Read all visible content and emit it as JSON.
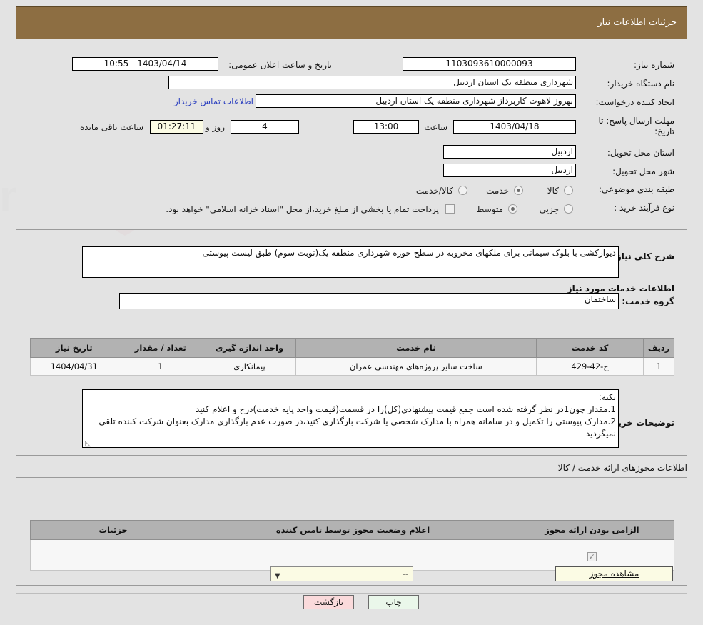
{
  "header": {
    "title": "جزئیات اطلاعات نیاز"
  },
  "summary": {
    "need_number_label": "شماره نیاز:",
    "need_number_value": "1103093610000093",
    "announce_label": "تاریخ و ساعت اعلان عمومی:",
    "announce_value": "1403/04/14 - 10:55",
    "buyer_org_label": "نام دستگاه خریدار:",
    "buyer_org_value": "شهرداری منطقه یک استان اردبیل",
    "creator_label": "ایجاد کننده درخواست:",
    "creator_value": "بهروز لاهوت کاربرداز شهرداری منطقه یک استان اردبیل",
    "contact_link": "اطلاعات تماس خریدار",
    "deadline_label": "مهلت ارسال پاسخ: تا تاریخ:",
    "deadline_date": "1403/04/18",
    "hour_label": "ساعت",
    "deadline_time": "13:00",
    "days_value": "4",
    "days_label": "روز و",
    "countdown_value": "01:27:11",
    "remaining_label": "ساعت باقی مانده",
    "province_label": "استان محل تحویل:",
    "province_value": "اردبیل",
    "city_label": "شهر محل تحویل:",
    "city_value": "اردبیل",
    "category_label": "طبقه بندی موضوعی:",
    "category_options": [
      {
        "label": "کالا",
        "selected": false
      },
      {
        "label": "خدمت",
        "selected": true
      },
      {
        "label": "کالا/خدمت",
        "selected": false
      }
    ],
    "process_label": "نوع فرآیند خرید :",
    "process_options": [
      {
        "label": "جزیی",
        "selected": false
      },
      {
        "label": "متوسط",
        "selected": true
      }
    ],
    "treasury_checkbox_checked": false,
    "treasury_text": "پرداخت تمام یا بخشی از مبلغ خرید،از محل \"اسناد خزانه اسلامی\" خواهد بود."
  },
  "description": {
    "label": "شرح کلی نیاز:",
    "value": "دیوارکشی با بلوک سیمانی برای ملکهای مخروبه در سطح حوزه شهرداری منطقه یک(نوبت سوم) طبق لیست پیوستی"
  },
  "services": {
    "section_title": "اطلاعات خدمات مورد نیاز",
    "group_label": "گروه خدمت:",
    "group_value": "ساختمان",
    "columns": [
      "ردیف",
      "کد خدمت",
      "نام خدمت",
      "واحد اندازه گیری",
      "تعداد / مقدار",
      "تاریخ نیاز"
    ],
    "rows": [
      {
        "row": "1",
        "code": "ج-42-429",
        "name": "ساخت سایر پروژه‌های مهندسی عمران",
        "unit": "پیمانکاری",
        "qty": "1",
        "need_date": "1404/04/31"
      }
    ]
  },
  "buyer_notes": {
    "label": "توضیحات خریدار:",
    "lines": [
      "نکته:",
      "1.مقدار چون1در نظر گرفته شده است جمع قیمت پیشنهادی(کل)را در قسمت(قیمت واحد پایه خدمت)درج و اعلام کنید",
      "2.مدارک پیوستی را تکمیل و در سامانه همراه با مدارک شخصی یا شرکت بارگذاری کنید،در صورت عدم بارگذاری مدارک بعنوان شرکت کننده تلقی نمیگردید"
    ]
  },
  "permits": {
    "section_title": "اطلاعات مجوزهای ارائه خدمت / کالا",
    "columns": [
      "الزامی بودن ارائه مجوز",
      "اعلام وضعیت مجوز توسط تامین کننده",
      "جزئیات"
    ],
    "rows": [
      {
        "required_checked": true,
        "status_value": "--",
        "detail_button": "مشاهده مجوز"
      }
    ]
  },
  "footer": {
    "print_label": "چاپ",
    "back_label": "بازگشت"
  },
  "colors": {
    "header_brown": "#8d6e42",
    "page_bg": "#e3e3e3",
    "table_header_gray": "#b2b2b2",
    "link_blue": "#2b3fbf",
    "yellow_field": "#fbfbe4",
    "print_green": "#eaf7ea",
    "back_pink": "#fadadb"
  }
}
